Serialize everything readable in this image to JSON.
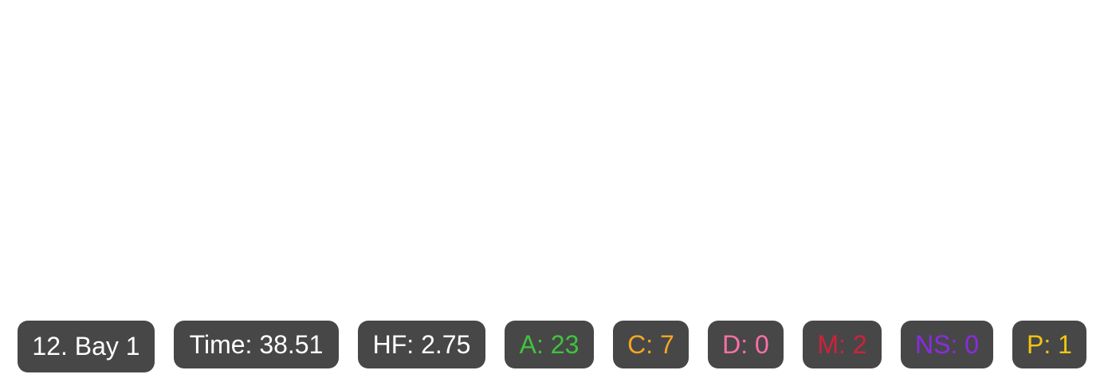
{
  "stats": {
    "stage": {
      "text": "12. Bay 1",
      "color": "#ffffff"
    },
    "time": {
      "text": "Time: 38.51",
      "color": "#ffffff"
    },
    "hit_factor": {
      "text": "HF: 2.75",
      "color": "#ffffff"
    },
    "alpha": {
      "text": "A: 23",
      "color": "#3ec43e"
    },
    "charlie": {
      "text": "C: 7",
      "color": "#f5a623"
    },
    "delta": {
      "text": "D: 0",
      "color": "#ff6fa8"
    },
    "miss": {
      "text": "M: 2",
      "color": "#d0213a"
    },
    "no_shoot": {
      "text": "NS: 0",
      "color": "#8a2be2"
    },
    "procedural": {
      "text": "P: 1",
      "color": "#f2c512"
    }
  },
  "colors": {
    "pill_background": "#474747",
    "page_background": "#ffffff"
  }
}
